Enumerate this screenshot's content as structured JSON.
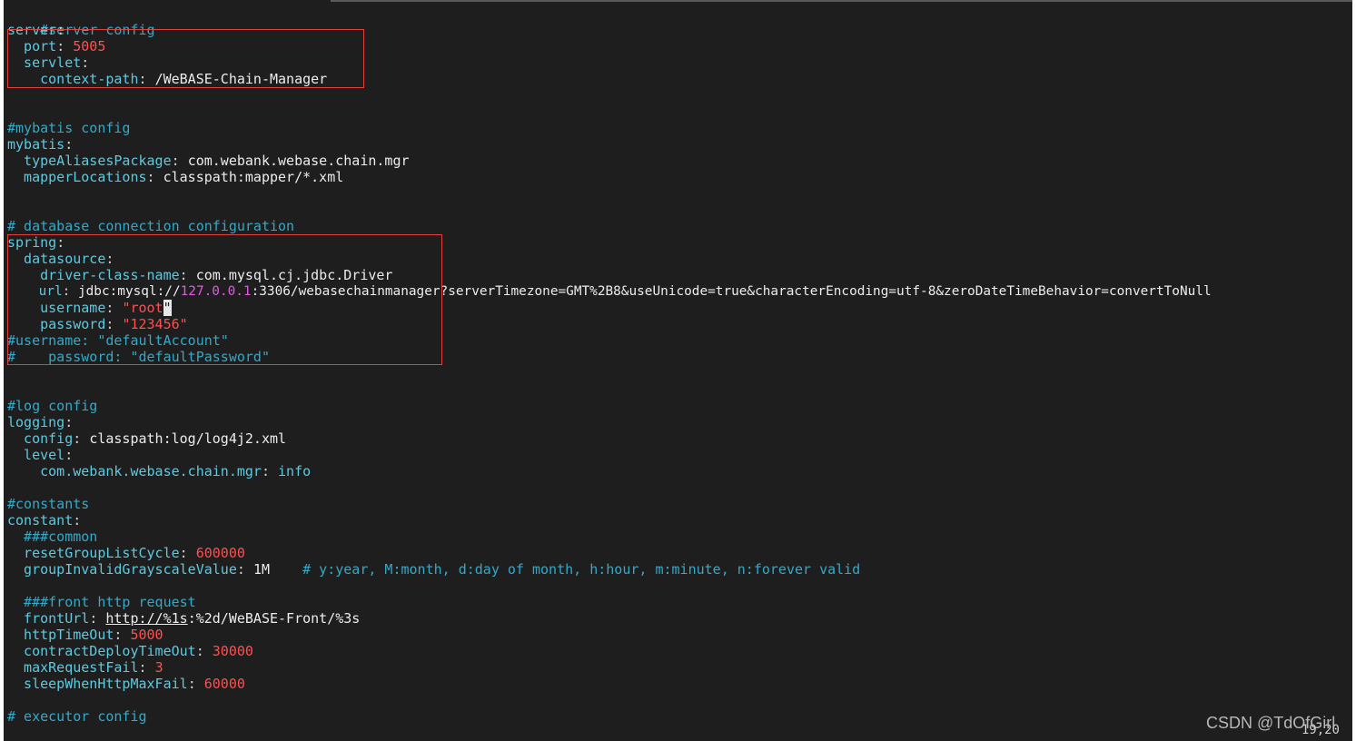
{
  "editor": {
    "lines": {
      "l0": {
        "c1": "#server config"
      },
      "l1": {
        "k1": "server",
        "p1": ":"
      },
      "l2": {
        "k1": "  port",
        "p1": ": ",
        "n1": "5005"
      },
      "l3": {
        "k1": "  servlet",
        "p1": ":"
      },
      "l4": {
        "k1": "    context-path",
        "p1": ": ",
        "v1": "/WeBASE-Chain-Manager"
      },
      "l7": {
        "c1": "#mybatis config"
      },
      "l8": {
        "k1": "mybatis",
        "p1": ":"
      },
      "l9": {
        "k1": "  typeAliasesPackage",
        "p1": ": ",
        "v1": "com.webank.webase.chain.mgr"
      },
      "l10": {
        "k1": "  mapperLocations",
        "p1": ": ",
        "v1": "classpath:mapper/*.xml"
      },
      "l13": {
        "c1": "# database connection configuration"
      },
      "l14": {
        "k1": "spring",
        "p1": ":"
      },
      "l15": {
        "k1": "  datasource",
        "p1": ":"
      },
      "l16": {
        "k1": "    driver-class-name",
        "p1": ": ",
        "v1": "com.mysql.cj.jdbc.Driver"
      },
      "l17": {
        "k1": "    url",
        "p1": ": ",
        "v1": "jdbc:mysql://",
        "m1": "127.0.0.1",
        "v2": ":3306/webasechainmanager?serverTimezone=GMT%2B8&useUnicode=true&characterEncoding=utf-8&zeroDateTimeBehavior=convertToNull"
      },
      "l18": {
        "k1": "    username",
        "p1": ": ",
        "n1": "\"root",
        "cur": "\""
      },
      "l19": {
        "k1": "    password",
        "p1": ": ",
        "n1": "\"123456\""
      },
      "l20": {
        "c1": "#username: \"defaultAccount\""
      },
      "l21": {
        "c1": "#    password: \"defaultPassword\""
      },
      "l24": {
        "c1": "#log config"
      },
      "l25": {
        "k1": "logging",
        "p1": ":"
      },
      "l26": {
        "k1": "  config",
        "p1": ": ",
        "v1": "classpath:log/log4j2.xml"
      },
      "l27": {
        "k1": "  level",
        "p1": ":"
      },
      "l28": {
        "k1": "    com.webank.webase.chain.mgr",
        "p1": ": ",
        "k2": "info"
      },
      "l30": {
        "c1": "#constants"
      },
      "l31": {
        "k1": "constant",
        "p1": ":"
      },
      "l32": {
        "c1": "  ###common"
      },
      "l33": {
        "k1": "  resetGroupListCycle",
        "p1": ": ",
        "n1": "600000"
      },
      "l34": {
        "k1": "  groupInvalidGrayscaleValue",
        "p1": ": ",
        "v1": "1M    ",
        "c1": "# y:year, M:month, d:day of month, h:hour, m:minute, n:forever valid"
      },
      "l36": {
        "c1": "  ###front http request"
      },
      "l37": {
        "k1": "  frontUrl",
        "p1": ": ",
        "u1": "http://%1s",
        "v1": ":%2d/WeBASE-Front/%3s"
      },
      "l38": {
        "k1": "  httpTimeOut",
        "p1": ": ",
        "n1": "5000"
      },
      "l39": {
        "k1": "  contractDeployTimeOut",
        "p1": ": ",
        "n1": "30000"
      },
      "l40": {
        "k1": "  maxRequestFail",
        "p1": ": ",
        "n1": "3"
      },
      "l41": {
        "k1": "  sleepWhenHttpMaxFail",
        "p1": ": ",
        "n1": "60000"
      },
      "l43": {
        "c1": "# executor config"
      }
    },
    "cursor_position": "19,20"
  },
  "watermark": "CSDN @TdOfGirl",
  "colors": {
    "background": "#1e1e1e",
    "key": "#5fc9e0",
    "comment": "#36a8c8",
    "literal": "#ff5050",
    "ip": "#e05ae0",
    "highlight_box": "#e0413d"
  }
}
